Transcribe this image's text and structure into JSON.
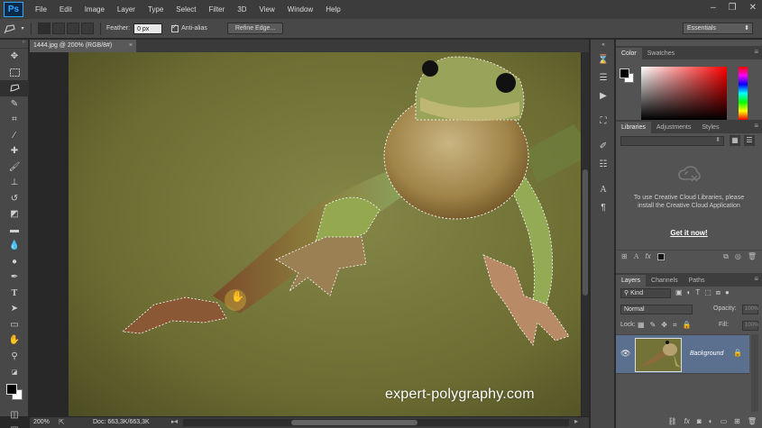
{
  "app": {
    "logo": "Ps"
  },
  "menu": [
    "File",
    "Edit",
    "Image",
    "Layer",
    "Type",
    "Select",
    "Filter",
    "3D",
    "View",
    "Window",
    "Help"
  ],
  "window_controls": {
    "minimize": "–",
    "maximize": "❐",
    "close": "✕"
  },
  "options": {
    "feather_label": "Feather:",
    "feather_value": "0 px",
    "antialias_label": "Anti-alias",
    "refine_edge_label": "Refine Edge...",
    "workspace": "Essentials"
  },
  "document": {
    "tab_title": "1444.jpg @ 200% (RGB/8#)",
    "watermark": "expert-polygraphy.com"
  },
  "status": {
    "zoom": "200%",
    "doc_info": "Doc: 663,3K/663,3K"
  },
  "panels": {
    "color_tabs": [
      "Color",
      "Swatches"
    ],
    "library_tabs": [
      "Libraries",
      "Adjustments",
      "Styles"
    ],
    "library_message": "To use Creative Cloud Libraries, please install the Creative Cloud Application",
    "library_link": "Get it now!",
    "layers_tabs": [
      "Layers",
      "Channels",
      "Paths"
    ],
    "layer_filter": "Kind",
    "blend_mode": "Normal",
    "opacity_label": "Opacity:",
    "opacity_value": "100%",
    "lock_label": "Lock:",
    "fill_label": "Fill:",
    "fill_value": "100%",
    "layer_name": "Background"
  },
  "colors": {
    "foreground": "#000000",
    "background": "#ffffff",
    "layer_selection": "#5b6f8e",
    "accent": "#31a8ff"
  }
}
